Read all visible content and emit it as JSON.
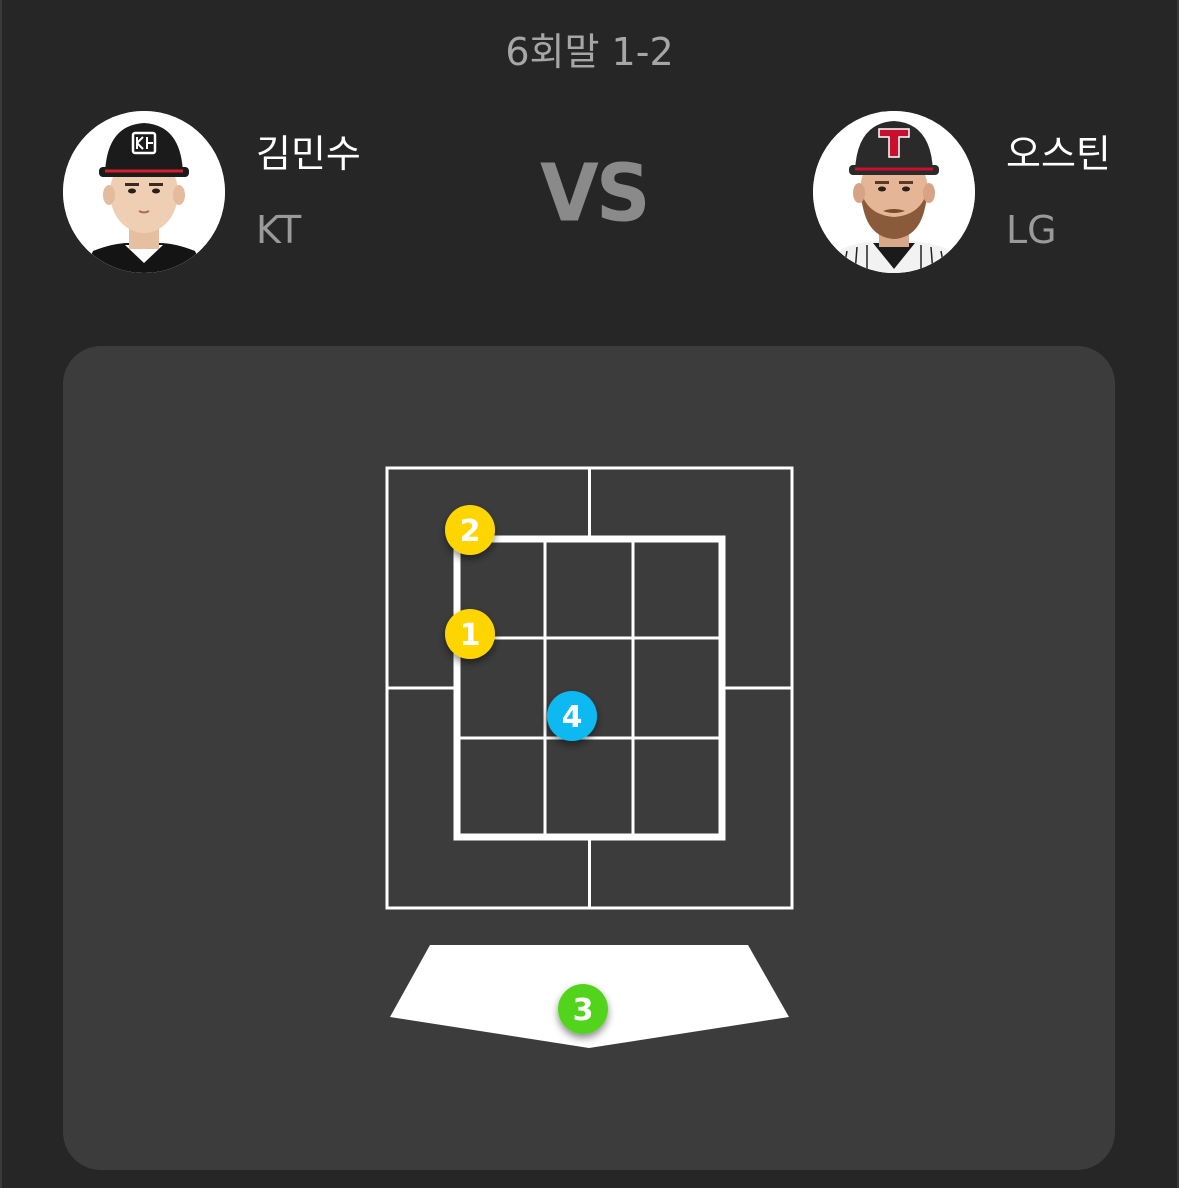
{
  "header": {
    "inning_label": "6회말 1-2"
  },
  "matchup": {
    "pitcher": {
      "name": "김민수",
      "team": "KT",
      "avatar_icon": "player-photo-kt"
    },
    "batter": {
      "name": "오스틴",
      "team": "LG",
      "avatar_icon": "player-photo-lg"
    },
    "vs_label": "VS"
  },
  "pitches": [
    {
      "number": "1",
      "color": "#ffd500",
      "zone": "top-left outer edge"
    },
    {
      "number": "2",
      "color": "#ffd500",
      "zone": "top-left corner"
    },
    {
      "number": "3",
      "color": "#52d41c",
      "zone": "home plate / dirt"
    },
    {
      "number": "4",
      "color": "#0fb9f0",
      "zone": "middle"
    }
  ],
  "colors": {
    "background": "#262626",
    "panel": "#3c3c3c",
    "zone_lines": "#ffffff",
    "kt_cap": "#1b1b1b",
    "lg_cap": "#2a2a2a",
    "lg_logo": "#c8102e"
  }
}
